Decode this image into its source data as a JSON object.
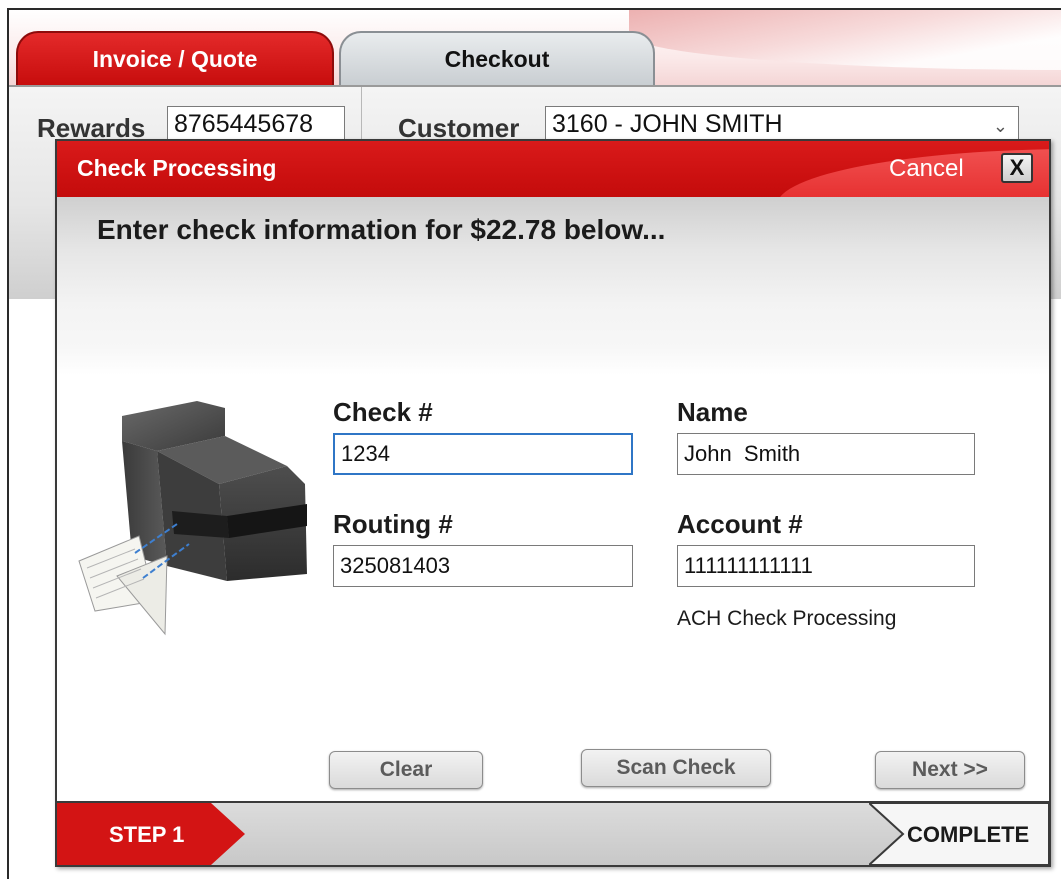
{
  "tabs": [
    {
      "label": "Invoice / Quote"
    },
    {
      "label": "Checkout"
    }
  ],
  "background_form": {
    "rewards_label": "Rewards",
    "rewards_value": "8765445678",
    "customer_label": "Customer",
    "customer_value": "3160 - JOHN SMITH"
  },
  "dialog": {
    "title": "Check Processing",
    "cancel_label": "Cancel",
    "close_glyph": "X",
    "instruction": "Enter check information for $22.78 below...",
    "fields": {
      "check_label": "Check #",
      "check_value": "1234",
      "name_label": "Name",
      "name_value": "John  Smith",
      "routing_label": "Routing #",
      "routing_value": "325081403",
      "account_label": "Account #",
      "account_value": "111111111111"
    },
    "processing_note": "ACH Check Processing",
    "buttons": {
      "clear": "Clear",
      "scan": "Scan Check",
      "next": "Next >>"
    },
    "steps": {
      "step1": "STEP 1",
      "complete": "COMPLETE"
    },
    "illustration_icon": "check-scanner-icon"
  },
  "colors": {
    "brand_red": "#d31414",
    "focus_blue": "#2f76c6",
    "gray_bar": "#c8c8c8"
  }
}
